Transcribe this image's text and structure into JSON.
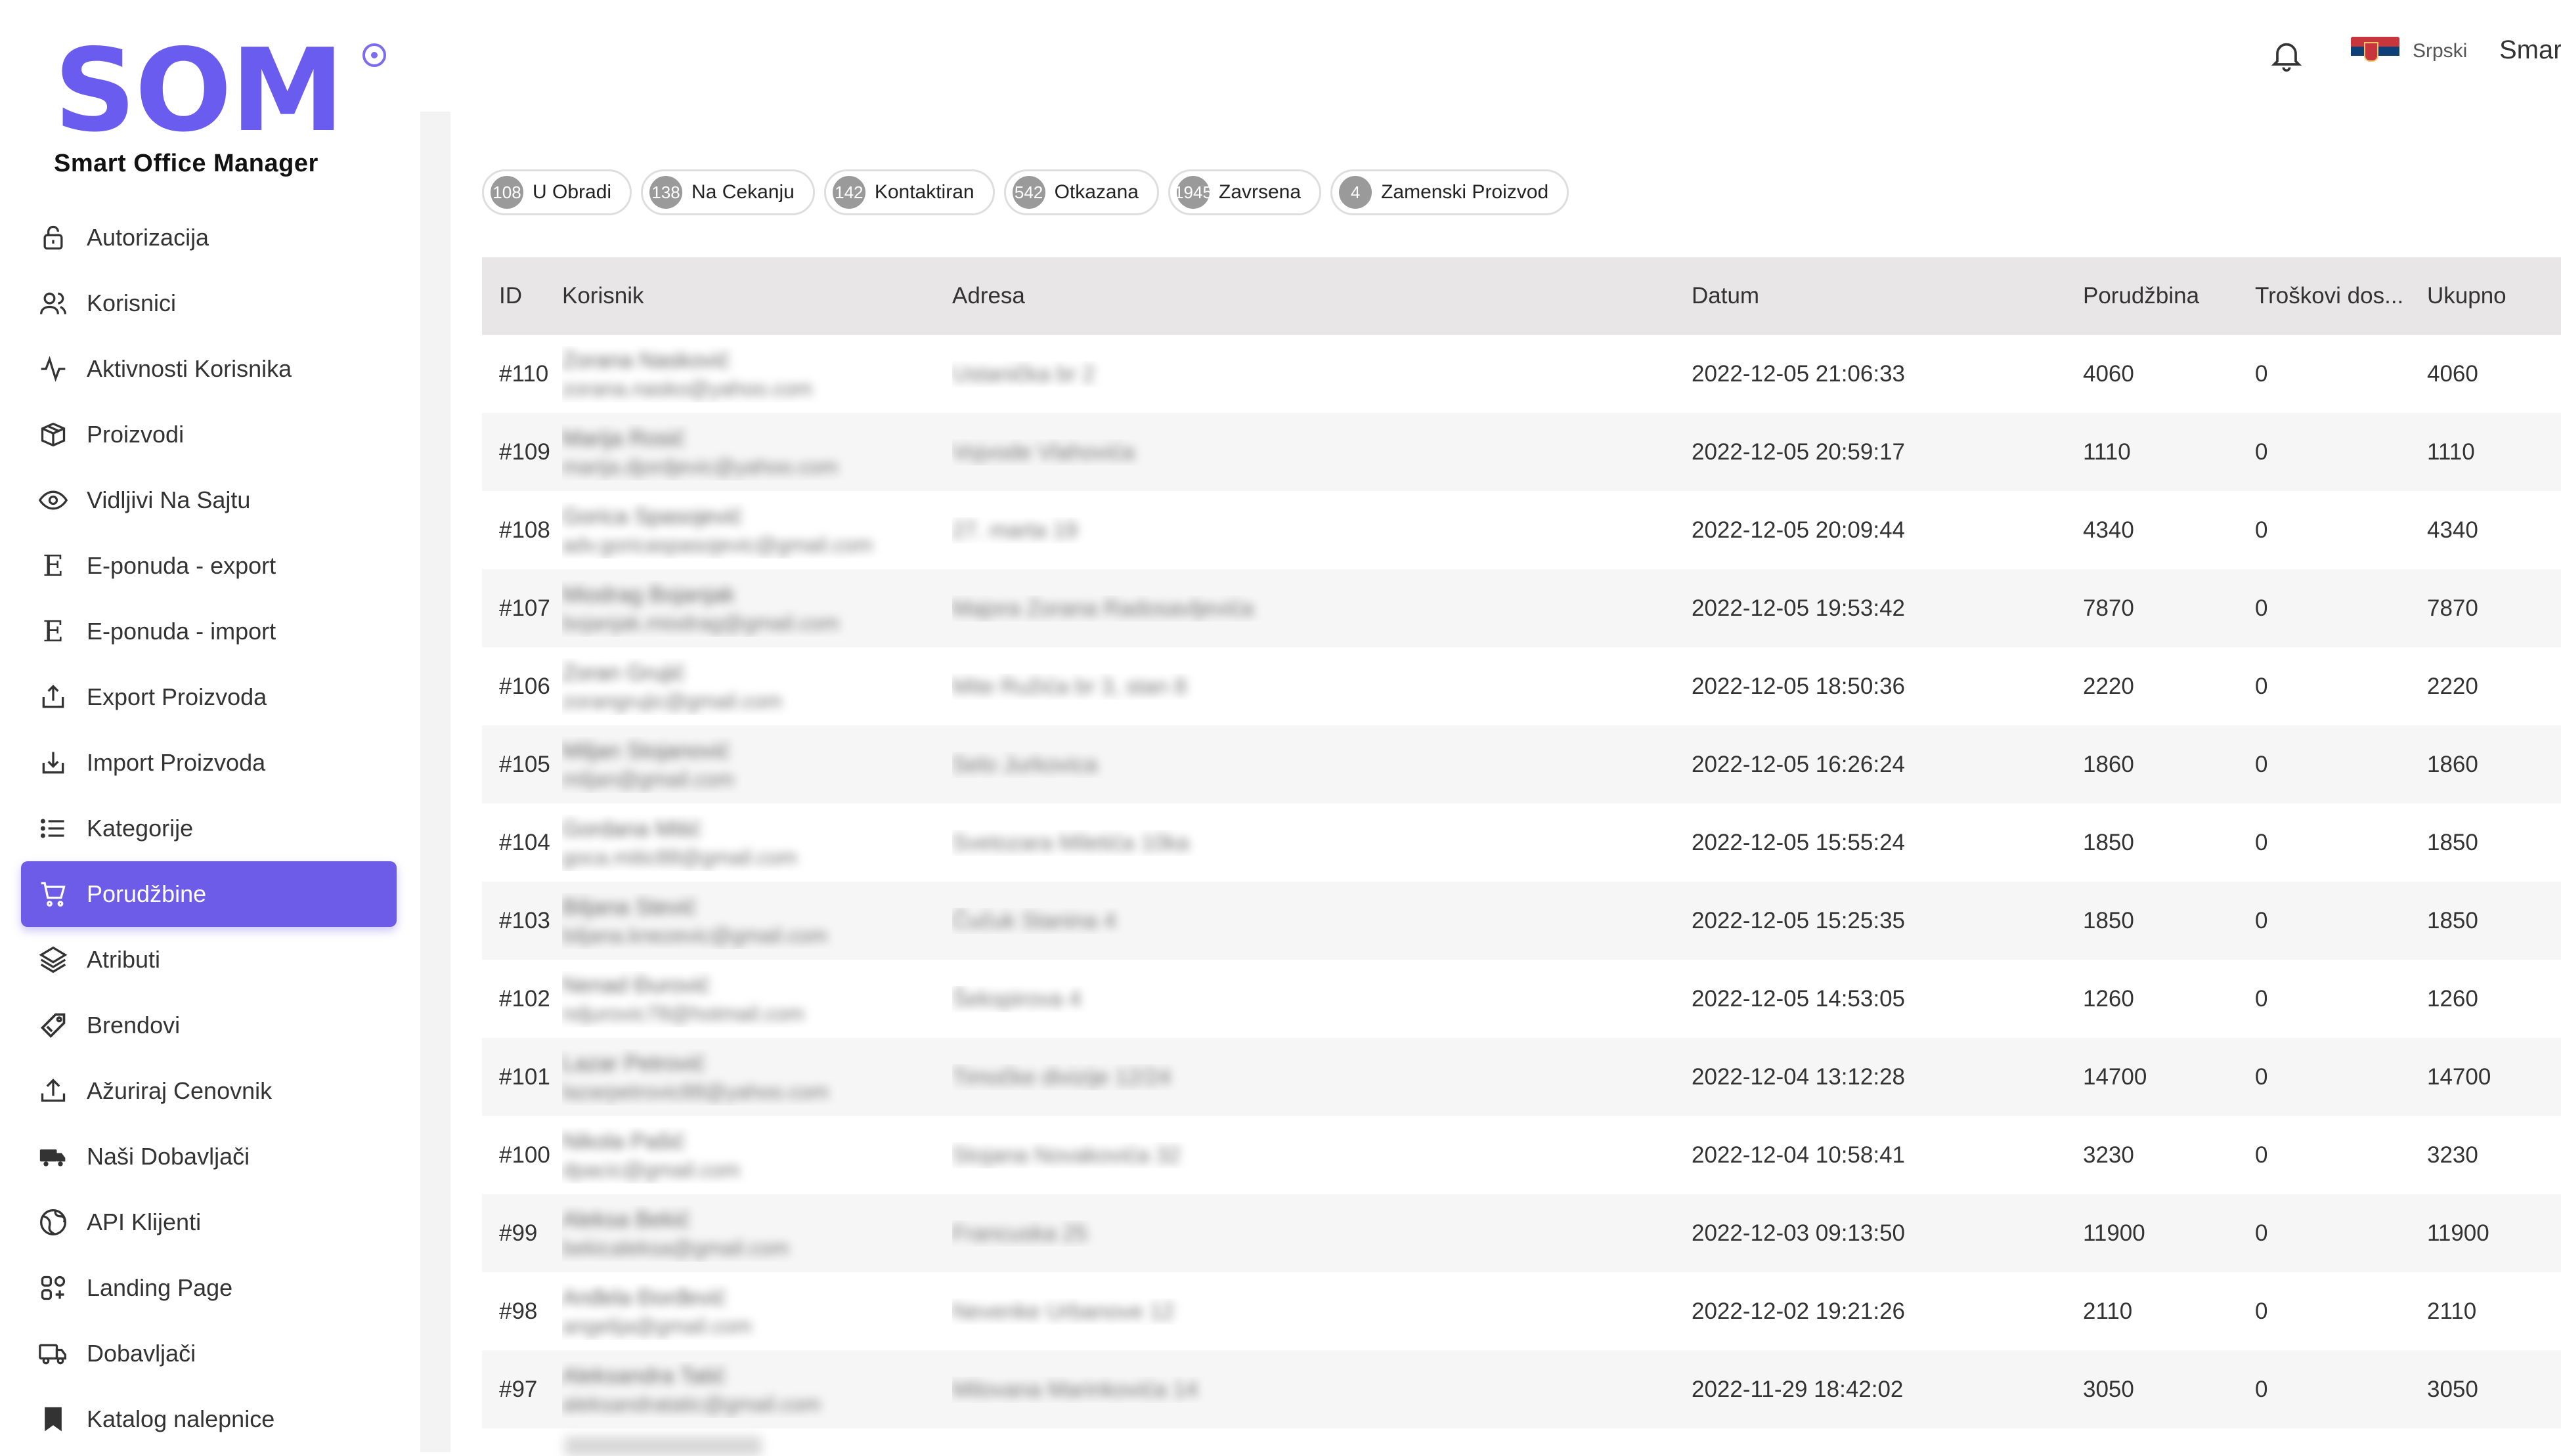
{
  "brand": {
    "logo": "SOM",
    "subtitle": "Smart Office Manager",
    "accent": "#6c5ce7"
  },
  "header": {
    "language": "Srpski",
    "user": "Smart"
  },
  "sidebar": {
    "items": [
      {
        "label": "Autorizacija",
        "icon": "lock-icon"
      },
      {
        "label": "Korisnici",
        "icon": "users-icon"
      },
      {
        "label": "Aktivnosti Korisnika",
        "icon": "activity-icon"
      },
      {
        "label": "Proizvodi",
        "icon": "box-icon"
      },
      {
        "label": "Vidljivi Na Sajtu",
        "icon": "eye-icon"
      },
      {
        "label": "E-ponuda - export",
        "icon": "e-letter-icon"
      },
      {
        "label": "E-ponuda - import",
        "icon": "e-letter-icon"
      },
      {
        "label": "Export Proizvoda",
        "icon": "upload-icon"
      },
      {
        "label": "Import Proizvoda",
        "icon": "download-icon"
      },
      {
        "label": "Kategorije",
        "icon": "list-icon"
      },
      {
        "label": "Porudžbine",
        "icon": "cart-icon",
        "active": true
      },
      {
        "label": "Atributi",
        "icon": "layers-icon"
      },
      {
        "label": "Brendovi",
        "icon": "tag-icon"
      },
      {
        "label": "Ažuriraj Cenovnik",
        "icon": "upload-icon"
      },
      {
        "label": "Naši Dobavljači",
        "icon": "truck-icon"
      },
      {
        "label": "API Klijenti",
        "icon": "globe-icon"
      },
      {
        "label": "Landing Page",
        "icon": "grid-icon"
      },
      {
        "label": "Dobavljači",
        "icon": "truck-outline-icon"
      },
      {
        "label": "Katalog nalepnice",
        "icon": "bookmark-icon"
      }
    ]
  },
  "status_chips": [
    {
      "count": "108",
      "label": "U Obradi"
    },
    {
      "count": "138",
      "label": "Na Cekanju"
    },
    {
      "count": "142",
      "label": "Kontaktiran"
    },
    {
      "count": "542",
      "label": "Otkazana"
    },
    {
      "count": "1945",
      "label": "Zavrsena"
    },
    {
      "count": "4",
      "label": "Zamenski Proizvod"
    }
  ],
  "table": {
    "headers": {
      "id": "ID",
      "user": "Korisnik",
      "address": "Adresa",
      "date": "Datum",
      "order": "Porudžbina",
      "shipping": "Troškovi dos...",
      "total": "Ukupno"
    },
    "rows": [
      {
        "id": "#110",
        "name": "Zorana Nasković",
        "email": "zorana.nasko@yahoo.com",
        "address": "Ustanička br 2",
        "date": "2022-12-05 21:06:33",
        "order": "4060",
        "shipping": "0",
        "total": "4060"
      },
      {
        "id": "#109",
        "name": "Marija Rosić",
        "email": "marija.djordjevic@yahoo.com",
        "address": "Vojvode Vlahovića",
        "date": "2022-12-05 20:59:17",
        "order": "1110",
        "shipping": "0",
        "total": "1110"
      },
      {
        "id": "#108",
        "name": "Gorica Spasojević",
        "email": "adv.goricaspasojevic@gmail.com",
        "address": "27. marta 19",
        "date": "2022-12-05 20:09:44",
        "order": "4340",
        "shipping": "0",
        "total": "4340"
      },
      {
        "id": "#107",
        "name": "Miodrag Bojanjak",
        "email": "bojanjak.miodrag@gmail.com",
        "address": "Majora Zorana Radosavljevića",
        "date": "2022-12-05 19:53:42",
        "order": "7870",
        "shipping": "0",
        "total": "7870"
      },
      {
        "id": "#106",
        "name": "Zoran Grujić",
        "email": "zorangrujic@gmail.com",
        "address": "Mite Ružića br 3, stan 8",
        "date": "2022-12-05 18:50:36",
        "order": "2220",
        "shipping": "0",
        "total": "2220"
      },
      {
        "id": "#105",
        "name": "Miljan Stojanović",
        "email": "miljan@gmail.com",
        "address": "Selo Jurkovica",
        "date": "2022-12-05 16:26:24",
        "order": "1860",
        "shipping": "0",
        "total": "1860"
      },
      {
        "id": "#104",
        "name": "Gordana Mitić",
        "email": "goca.mitic88@gmail.com",
        "address": "Svetozara Miletića 10ka",
        "date": "2022-12-05 15:55:24",
        "order": "1850",
        "shipping": "0",
        "total": "1850"
      },
      {
        "id": "#103",
        "name": "Biljana Stević",
        "email": "biljana.knezevic@gmail.com",
        "address": "Čučuk Stanina 4",
        "date": "2022-12-05 15:25:35",
        "order": "1850",
        "shipping": "0",
        "total": "1850"
      },
      {
        "id": "#102",
        "name": "Nenad Đurović",
        "email": "ndjurovic78@hotmail.com",
        "address": "Šekspirova 4",
        "date": "2022-12-05 14:53:05",
        "order": "1260",
        "shipping": "0",
        "total": "1260"
      },
      {
        "id": "#101",
        "name": "Lazar Petrović",
        "email": "lazarpetrovic88@yahoo.com",
        "address": "Timočke divizije 12/24",
        "date": "2022-12-04 13:12:28",
        "order": "14700",
        "shipping": "0",
        "total": "14700"
      },
      {
        "id": "#100",
        "name": "Nikola Pašić",
        "email": "dpacic@gmail.com",
        "address": "Stojana Novakovića 32",
        "date": "2022-12-04 10:58:41",
        "order": "3230",
        "shipping": "0",
        "total": "3230"
      },
      {
        "id": "#99",
        "name": "Aleksa Bekić",
        "email": "bekicaleksa@gmail.com",
        "address": "Francuska 25",
        "date": "2022-12-03 09:13:50",
        "order": "11900",
        "shipping": "0",
        "total": "11900"
      },
      {
        "id": "#98",
        "name": "Anđela Đorđević",
        "email": "angelija@gmail.com",
        "address": "Nevenke Urbanove 12",
        "date": "2022-12-02 19:21:26",
        "order": "2110",
        "shipping": "0",
        "total": "2110"
      },
      {
        "id": "#97",
        "name": "Aleksandra Tatić",
        "email": "aleksandratatic@gmail.com",
        "address": "Milovana Marinkovića 14",
        "date": "2022-11-29 18:42:02",
        "order": "3050",
        "shipping": "0",
        "total": "3050"
      }
    ]
  }
}
